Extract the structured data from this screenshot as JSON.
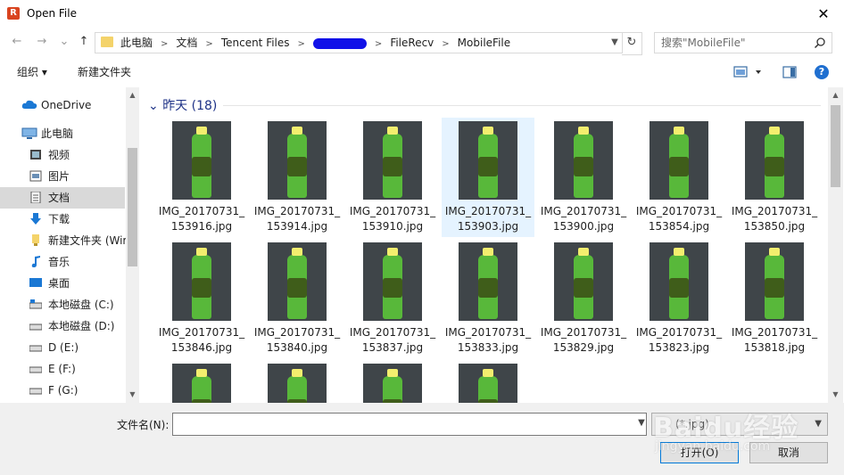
{
  "window": {
    "title": "Open File",
    "close_glyph": "✕"
  },
  "nav": {
    "back_glyph": "←",
    "forward_glyph": "→",
    "recent_glyph": "⌄",
    "up_glyph": "↑",
    "breadcrumbs": [
      "此电脑",
      "文档",
      "Tencent Files",
      "",
      "FileRecv",
      "MobileFile"
    ],
    "refresh_glyph": "↻",
    "search_placeholder": "搜索\"MobileFile\""
  },
  "toolbar": {
    "organize_label": "组织 ▾",
    "new_folder_label": "新建文件夹",
    "help_glyph": "?"
  },
  "sidebar": {
    "items": [
      {
        "label": "OneDrive",
        "icon": "cloud-icon",
        "selected": false
      },
      {
        "label": "此电脑",
        "icon": "computer-icon",
        "selected": false
      },
      {
        "label": "视频",
        "icon": "video-icon",
        "selected": false
      },
      {
        "label": "图片",
        "icon": "picture-icon",
        "selected": false
      },
      {
        "label": "文档",
        "icon": "document-icon",
        "selected": true
      },
      {
        "label": "下载",
        "icon": "download-icon",
        "selected": false
      },
      {
        "label": "新建文件夹 (Wir",
        "icon": "folder-icon",
        "selected": false
      },
      {
        "label": "音乐",
        "icon": "music-icon",
        "selected": false
      },
      {
        "label": "桌面",
        "icon": "desktop-icon",
        "selected": false
      },
      {
        "label": "本地磁盘 (C:)",
        "icon": "drive-icon",
        "selected": false
      },
      {
        "label": "本地磁盘 (D:)",
        "icon": "drive-icon",
        "selected": false
      },
      {
        "label": "D (E:)",
        "icon": "drive-icon",
        "selected": false
      },
      {
        "label": "E (F:)",
        "icon": "drive-icon",
        "selected": false
      },
      {
        "label": "F (G:)",
        "icon": "drive-icon",
        "selected": false
      }
    ]
  },
  "content": {
    "group_header": "昨天 (18)",
    "files": [
      {
        "line1": "IMG_20170731_",
        "line2": "153916.jpg"
      },
      {
        "line1": "IMG_20170731_",
        "line2": "153914.jpg"
      },
      {
        "line1": "IMG_20170731_",
        "line2": "153910.jpg"
      },
      {
        "line1": "IMG_20170731_",
        "line2": "153903.jpg"
      },
      {
        "line1": "IMG_20170731_",
        "line2": "153900.jpg"
      },
      {
        "line1": "IMG_20170731_",
        "line2": "153854.jpg"
      },
      {
        "line1": "IMG_20170731_",
        "line2": "153850.jpg"
      },
      {
        "line1": "IMG_20170731_",
        "line2": "153846.jpg"
      },
      {
        "line1": "IMG_20170731_",
        "line2": "153840.jpg"
      },
      {
        "line1": "IMG_20170731_",
        "line2": "153837.jpg"
      },
      {
        "line1": "IMG_20170731_",
        "line2": "153833.jpg"
      },
      {
        "line1": "IMG_20170731_",
        "line2": "153829.jpg"
      },
      {
        "line1": "IMG_20170731_",
        "line2": "153823.jpg"
      },
      {
        "line1": "IMG_20170731_",
        "line2": "153818.jpg"
      },
      {
        "line1": "",
        "line2": ""
      },
      {
        "line1": "",
        "line2": ""
      },
      {
        "line1": "",
        "line2": ""
      },
      {
        "line1": "",
        "line2": ""
      }
    ]
  },
  "footer": {
    "filename_label": "文件名(N):",
    "filename_value": "",
    "filetype_value": "(*.jpg)",
    "open_label": "打开(O)",
    "cancel_label": "取消"
  },
  "watermark": {
    "text": "Baidu经验",
    "sub": "jingyan.baidu.com"
  },
  "colors": {
    "accent": "#0078d7",
    "selection": "#e5f3ff",
    "group_header": "#1e3287",
    "redaction": "#1111e8"
  }
}
